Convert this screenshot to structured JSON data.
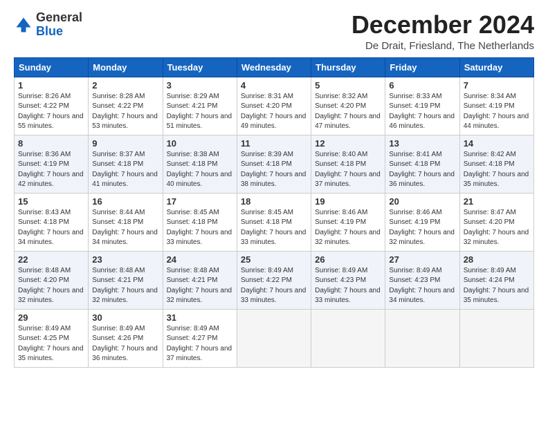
{
  "header": {
    "logo_general": "General",
    "logo_blue": "Blue",
    "month_title": "December 2024",
    "location": "De Drait, Friesland, The Netherlands"
  },
  "weekdays": [
    "Sunday",
    "Monday",
    "Tuesday",
    "Wednesday",
    "Thursday",
    "Friday",
    "Saturday"
  ],
  "weeks": [
    [
      {
        "day": 1,
        "sunrise": "8:26 AM",
        "sunset": "4:22 PM",
        "daylight": "7 hours and 55 minutes"
      },
      {
        "day": 2,
        "sunrise": "8:28 AM",
        "sunset": "4:22 PM",
        "daylight": "7 hours and 53 minutes"
      },
      {
        "day": 3,
        "sunrise": "8:29 AM",
        "sunset": "4:21 PM",
        "daylight": "7 hours and 51 minutes"
      },
      {
        "day": 4,
        "sunrise": "8:31 AM",
        "sunset": "4:20 PM",
        "daylight": "7 hours and 49 minutes"
      },
      {
        "day": 5,
        "sunrise": "8:32 AM",
        "sunset": "4:20 PM",
        "daylight": "7 hours and 47 minutes"
      },
      {
        "day": 6,
        "sunrise": "8:33 AM",
        "sunset": "4:19 PM",
        "daylight": "7 hours and 46 minutes"
      },
      {
        "day": 7,
        "sunrise": "8:34 AM",
        "sunset": "4:19 PM",
        "daylight": "7 hours and 44 minutes"
      }
    ],
    [
      {
        "day": 8,
        "sunrise": "8:36 AM",
        "sunset": "4:19 PM",
        "daylight": "7 hours and 42 minutes"
      },
      {
        "day": 9,
        "sunrise": "8:37 AM",
        "sunset": "4:18 PM",
        "daylight": "7 hours and 41 minutes"
      },
      {
        "day": 10,
        "sunrise": "8:38 AM",
        "sunset": "4:18 PM",
        "daylight": "7 hours and 40 minutes"
      },
      {
        "day": 11,
        "sunrise": "8:39 AM",
        "sunset": "4:18 PM",
        "daylight": "7 hours and 38 minutes"
      },
      {
        "day": 12,
        "sunrise": "8:40 AM",
        "sunset": "4:18 PM",
        "daylight": "7 hours and 37 minutes"
      },
      {
        "day": 13,
        "sunrise": "8:41 AM",
        "sunset": "4:18 PM",
        "daylight": "7 hours and 36 minutes"
      },
      {
        "day": 14,
        "sunrise": "8:42 AM",
        "sunset": "4:18 PM",
        "daylight": "7 hours and 35 minutes"
      }
    ],
    [
      {
        "day": 15,
        "sunrise": "8:43 AM",
        "sunset": "4:18 PM",
        "daylight": "7 hours and 34 minutes"
      },
      {
        "day": 16,
        "sunrise": "8:44 AM",
        "sunset": "4:18 PM",
        "daylight": "7 hours and 34 minutes"
      },
      {
        "day": 17,
        "sunrise": "8:45 AM",
        "sunset": "4:18 PM",
        "daylight": "7 hours and 33 minutes"
      },
      {
        "day": 18,
        "sunrise": "8:45 AM",
        "sunset": "4:18 PM",
        "daylight": "7 hours and 33 minutes"
      },
      {
        "day": 19,
        "sunrise": "8:46 AM",
        "sunset": "4:19 PM",
        "daylight": "7 hours and 32 minutes"
      },
      {
        "day": 20,
        "sunrise": "8:46 AM",
        "sunset": "4:19 PM",
        "daylight": "7 hours and 32 minutes"
      },
      {
        "day": 21,
        "sunrise": "8:47 AM",
        "sunset": "4:20 PM",
        "daylight": "7 hours and 32 minutes"
      }
    ],
    [
      {
        "day": 22,
        "sunrise": "8:48 AM",
        "sunset": "4:20 PM",
        "daylight": "7 hours and 32 minutes"
      },
      {
        "day": 23,
        "sunrise": "8:48 AM",
        "sunset": "4:21 PM",
        "daylight": "7 hours and 32 minutes"
      },
      {
        "day": 24,
        "sunrise": "8:48 AM",
        "sunset": "4:21 PM",
        "daylight": "7 hours and 32 minutes"
      },
      {
        "day": 25,
        "sunrise": "8:49 AM",
        "sunset": "4:22 PM",
        "daylight": "7 hours and 33 minutes"
      },
      {
        "day": 26,
        "sunrise": "8:49 AM",
        "sunset": "4:23 PM",
        "daylight": "7 hours and 33 minutes"
      },
      {
        "day": 27,
        "sunrise": "8:49 AM",
        "sunset": "4:23 PM",
        "daylight": "7 hours and 34 minutes"
      },
      {
        "day": 28,
        "sunrise": "8:49 AM",
        "sunset": "4:24 PM",
        "daylight": "7 hours and 35 minutes"
      }
    ],
    [
      {
        "day": 29,
        "sunrise": "8:49 AM",
        "sunset": "4:25 PM",
        "daylight": "7 hours and 35 minutes"
      },
      {
        "day": 30,
        "sunrise": "8:49 AM",
        "sunset": "4:26 PM",
        "daylight": "7 hours and 36 minutes"
      },
      {
        "day": 31,
        "sunrise": "8:49 AM",
        "sunset": "4:27 PM",
        "daylight": "7 hours and 37 minutes"
      },
      null,
      null,
      null,
      null
    ]
  ]
}
